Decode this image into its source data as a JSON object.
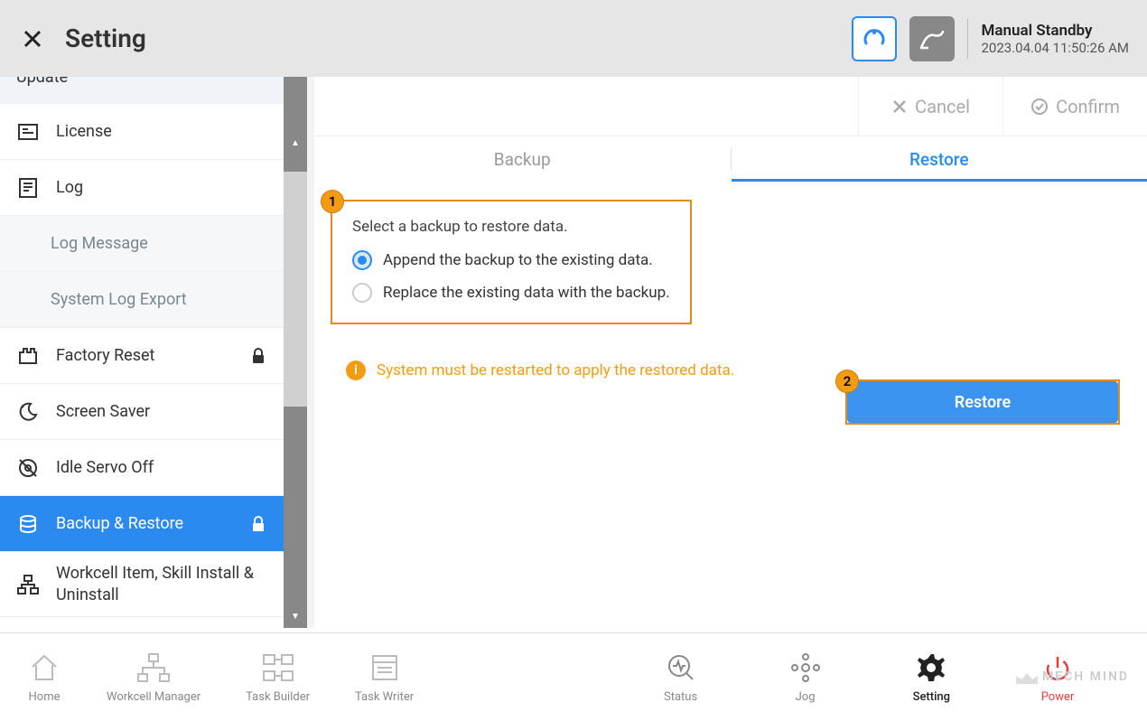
{
  "header": {
    "title": "Setting",
    "status_title": "Manual Standby",
    "status_time": "2023.04.04 11:50:26 AM"
  },
  "sidebar": {
    "items": [
      {
        "label": "Update"
      },
      {
        "label": "License"
      },
      {
        "label": "Log"
      },
      {
        "label": "Log Message"
      },
      {
        "label": "System Log Export"
      },
      {
        "label": "Factory Reset"
      },
      {
        "label": "Screen Saver"
      },
      {
        "label": "Idle Servo Off"
      },
      {
        "label": "Backup & Restore"
      },
      {
        "label": "Workcell Item, Skill Install & Uninstall"
      }
    ]
  },
  "actions": {
    "cancel": "Cancel",
    "confirm": "Confirm"
  },
  "tabs": {
    "backup": "Backup",
    "restore": "Restore"
  },
  "restore": {
    "prompt": "Select a backup to restore data.",
    "option_append": "Append the backup to the existing data.",
    "option_replace": "Replace the existing data with the backup.",
    "warning": "System must be restarted to apply the restored data.",
    "button": "Restore"
  },
  "badges": {
    "one": "1",
    "two": "2"
  },
  "footer": {
    "home": "Home",
    "workcell": "Workcell Manager",
    "taskbuilder": "Task Builder",
    "taskwriter": "Task Writer",
    "status": "Status",
    "jog": "Jog",
    "setting": "Setting",
    "power": "Power"
  },
  "watermark": "MECH MIND"
}
